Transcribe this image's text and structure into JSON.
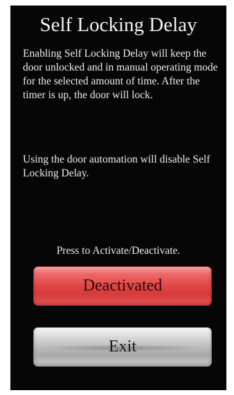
{
  "screen": {
    "title": "Self Locking Delay",
    "description_1": "Enabling Self Locking Delay will keep the door unlocked and in manual operating mode for the selected amount of time. After the timer is up, the door will lock.",
    "description_2": "Using the door automation will disable Self Locking Delay.",
    "prompt": "Press to Activate/Deactivate.",
    "toggle_button_label": "Deactivated",
    "exit_button_label": "Exit"
  },
  "colors": {
    "background": "#060606",
    "text": "#ededed",
    "toggle_button": "#e24848",
    "exit_button": "#bdbdbd"
  }
}
